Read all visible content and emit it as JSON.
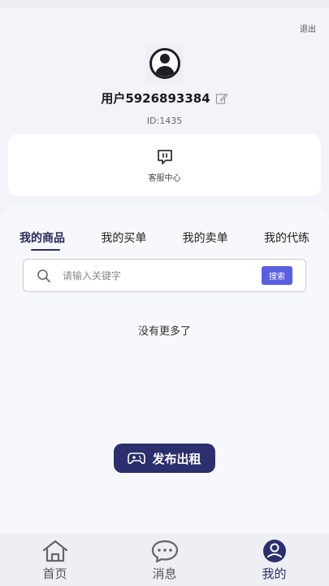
{
  "header": {
    "logout_label": "退出"
  },
  "profile": {
    "username": "用户5926893384",
    "user_id": "ID:1435"
  },
  "service": {
    "label": "客服中心"
  },
  "tabs": [
    {
      "label": "我的商品",
      "active": true
    },
    {
      "label": "我的买单",
      "active": false
    },
    {
      "label": "我的卖单",
      "active": false
    },
    {
      "label": "我的代练",
      "active": false
    }
  ],
  "search": {
    "placeholder": "请输入关键字",
    "button_label": "搜索"
  },
  "content": {
    "empty_text": "没有更多了"
  },
  "publish": {
    "label": "发布出租"
  },
  "bottom_nav": [
    {
      "label": "首页",
      "icon": "home-icon",
      "active": false
    },
    {
      "label": "消息",
      "icon": "message-icon",
      "active": false
    },
    {
      "label": "我的",
      "icon": "profile-icon",
      "active": true
    }
  ],
  "colors": {
    "accent": "#2b2f6e",
    "search_button": "#5a5ee0",
    "background": "#f3f4f9"
  }
}
